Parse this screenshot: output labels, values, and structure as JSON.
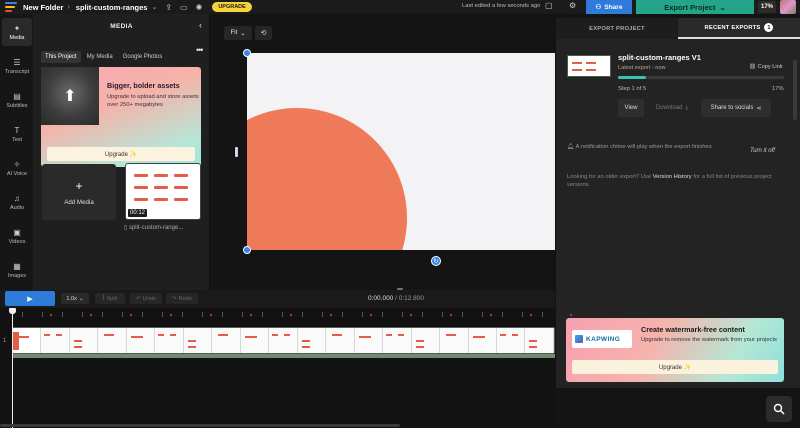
{
  "colors": {
    "accent": "#2f7bd9",
    "export": "#24a589",
    "upgrade": "#f5d33b",
    "canvas_bg": "#f3f3f5",
    "shape": "#ee7a5a",
    "progress": "#3ec2b0"
  },
  "topbar": {
    "folder": "New Folder",
    "project": "split-custom-ranges",
    "upgrade_label": "UPGRADE",
    "last_edited": "Last edited a few seconds ago",
    "share_label": "Share",
    "export_label": "Export Project",
    "percent": "17%",
    "icons": [
      "logo",
      "chevron-right-icon",
      "chevron-down-icon",
      "upload-icon",
      "monitor-icon",
      "lightbulb-icon",
      "comment-icon",
      "gear-icon",
      "users-icon"
    ]
  },
  "rail": [
    {
      "label": "Media",
      "icon": "media-icon",
      "glyph": "✦",
      "active": true
    },
    {
      "label": "Transcript",
      "icon": "transcript-icon",
      "glyph": "☰"
    },
    {
      "label": "Subtitles",
      "icon": "subtitles-icon",
      "glyph": "▤"
    },
    {
      "label": "Text",
      "icon": "text-icon",
      "glyph": "T"
    },
    {
      "label": "AI Voice",
      "icon": "ai-voice-icon",
      "glyph": "✧"
    },
    {
      "label": "Audio",
      "icon": "audio-icon",
      "glyph": "♫"
    },
    {
      "label": "Videos",
      "icon": "videos-icon",
      "glyph": "▣"
    },
    {
      "label": "Images",
      "icon": "images-icon",
      "glyph": "▦"
    }
  ],
  "media": {
    "header": "MEDIA",
    "tabs": [
      "This Project",
      "My Media",
      "Google Photos"
    ],
    "upsell_title": "Bigger, bolder assets",
    "upsell_body": "Upgrade to upload and store assets over 250+ megabytes",
    "upsell_button": "Upgrade ✨",
    "add_media": "Add Media",
    "thumb_duration": "00:12",
    "thumb_name": "split-custom-range..."
  },
  "stage": {
    "fit_label": "Fit"
  },
  "export_panel": {
    "tab_project": "EXPORT PROJECT",
    "tab_recent": "RECENT EXPORTS",
    "recent_count": "1",
    "export_name": "split-custom-ranges V1",
    "export_meta": "Latest export - now",
    "copy_link": "Copy Link",
    "progress_fraction": 0.17,
    "step_text": "Step 1 of 5",
    "step_percent": "17%",
    "view": "View",
    "download": "Download",
    "share_socials": "Share to socials",
    "notice": "A notification chime will play when the export finishes",
    "turn_off": "Turn it off",
    "older_pre": "Looking for an older export? Use ",
    "older_link": "Version History",
    "older_post": " for a full list of previous project versions."
  },
  "watermark": {
    "logo_text": "KAPWING",
    "title": "Create watermark-free content",
    "body": "Upgrade to remove the watermark from your projects",
    "button": "Upgrade ✨"
  },
  "controls": {
    "speed": "1.0x",
    "split": "Split",
    "undo": "Undo",
    "redo": "Redo",
    "current_time": "0:00.000",
    "total_time": " / 0:12.800"
  },
  "timeline": {
    "track_number": "1",
    "frame_count": 19
  }
}
